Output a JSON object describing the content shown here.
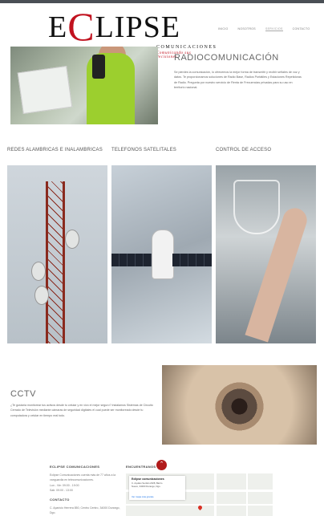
{
  "brand": {
    "name_prefix": "E",
    "name_c": "C",
    "name_suffix": "LIPSE",
    "tagline": "COMUNICACIONES",
    "slogan": "Comunicando sus decisiones",
    "accent_color": "#c1121f"
  },
  "nav": {
    "items": [
      "INICIO",
      "NOSOTROS",
      "SERVICIOS",
      "CONTACTO"
    ],
    "active_index": 2
  },
  "radio": {
    "title": "RADIOCOMUNICACIÓN",
    "text": "Se pierdes la comunicación, lo ofrecemos la mejor forma de transmitir y recibir señales de voz y datos. Te proporcionamos soluciones de Radio Base, Radios Portátiles y Estaciones Repetidoras de Radio. Pregunta por nuestro servicio de Renta de Frecuencias privadas para su uso en territorio nacional."
  },
  "categories": [
    {
      "label": "REDES ALAMBRICAS E INALAMBRICAS",
      "image_icon": "antenna-tower"
    },
    {
      "label": "TELEFONOS SATELITALES",
      "image_icon": "satellite"
    },
    {
      "label": "CONTROL DE ACCESO",
      "image_icon": "fingerprint-shield"
    }
  ],
  "cctv": {
    "title": "CCTV",
    "text": "¿Te gustaría monitorear tus activos desde tu celular y en vivo el mejor seguro? Instalamos Sistemas de Circuito Cerrado de Televisión mediante cámaras de seguridad digitales el cual puede ser monitoreado desde tu computadora y celular en tiempo real todo."
  },
  "footer": {
    "company_heading": "ECLIPSE COMUNICACIONES",
    "company_text": "Eclipse Comunicaciones cuenta más de 77 años a la vanguardia en telecomunicaciones.",
    "hours_1": "Lun - Vie: 09:00 - 19:00",
    "hours_2": "Sab: 09:00 - 13:00",
    "contact_heading": "CONTACTO",
    "contact_text": "C. Aparicio Herrera 850, Centro Centro, 34000 Durango, Dgo.",
    "location_heading": "ENCUENTRANOS",
    "map_title": "Eclipse comunicaciones",
    "map_address": "C. Aquiles Serdán 2028, Barrio Nuevo, 34000 Durango, Dgo.",
    "map_rating": "4.4 ★★★★★  13 reseñas",
    "map_link": "Ver mapa más grande",
    "scroll_top": "⌃"
  }
}
